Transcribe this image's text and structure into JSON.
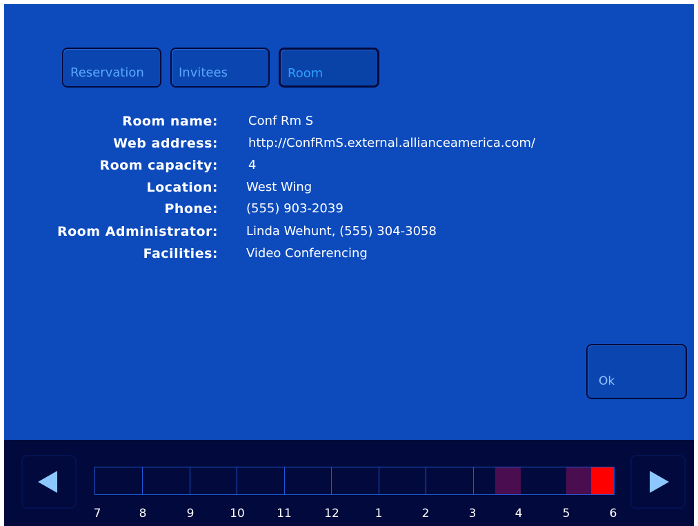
{
  "tabs": [
    {
      "label": "Reservation",
      "active": false
    },
    {
      "label": "Invitees",
      "active": false
    },
    {
      "label": "Room",
      "active": true
    }
  ],
  "room_info": [
    {
      "label": "Room name:",
      "value": "Conf Rm S"
    },
    {
      "label": "Web address:",
      "value": "http://ConfRmS.external.allianceamerica.com/"
    },
    {
      "label": "Room capacity:",
      "value": "4"
    },
    {
      "label": "Location:",
      "value": "West Wing"
    },
    {
      "label": "Phone:",
      "value": "(555) 903-2039"
    },
    {
      "label": "Room Administrator:",
      "value": "Linda Wehunt, (555) 304-3058"
    },
    {
      "label": "Facilities:",
      "value": "Video Conferencing"
    }
  ],
  "ok_button": {
    "label": "Ok"
  },
  "timeline": {
    "hour_labels": [
      "7",
      "8",
      "9",
      "10",
      "11",
      "12",
      "1",
      "2",
      "3",
      "4",
      "5",
      "6"
    ],
    "colors": {
      "background": "#020a3d",
      "booked": "#4a0d4f",
      "selected": "#ff0000",
      "grid": "#1e5ad8"
    }
  },
  "nav": {
    "prev_icon": "arrow-left-icon",
    "next_icon": "arrow-right-icon"
  },
  "colors": {
    "screen_background": "#0d4bbd",
    "bar_background": "#020a3d",
    "tab_text": "#5aa8ff",
    "label_text": "#ffffff"
  }
}
